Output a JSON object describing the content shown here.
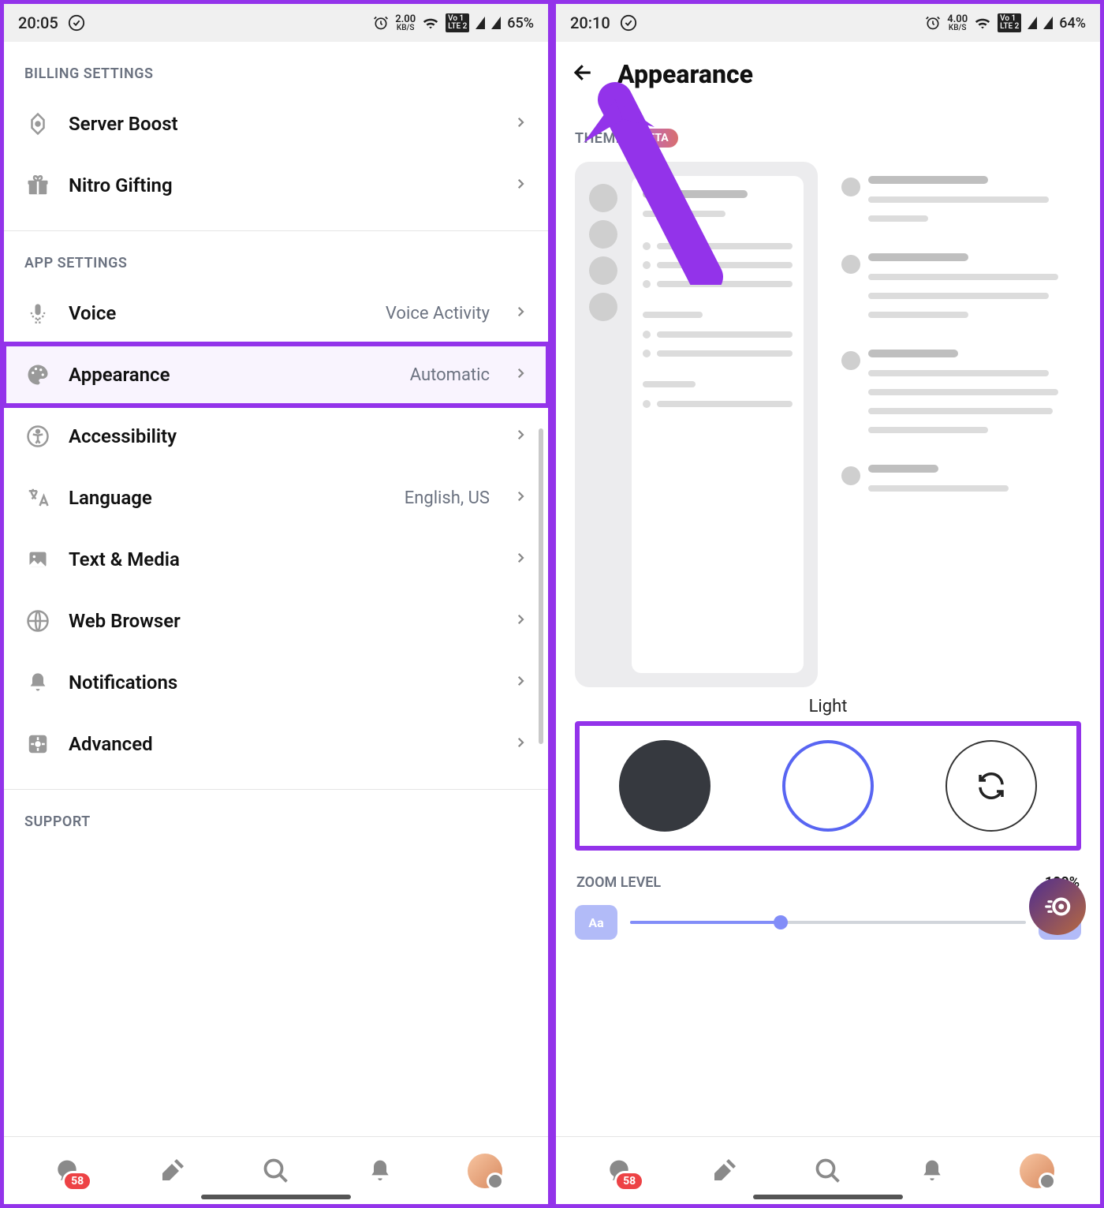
{
  "left": {
    "status": {
      "time": "20:05",
      "kbs_top": "2.00",
      "kbs_bot": "KB/S",
      "lte": "Vo 1\nLTE 2",
      "battery": "65%"
    },
    "sections": {
      "billing_header": "BILLING SETTINGS",
      "billing_items": [
        {
          "label": "Server Boost"
        },
        {
          "label": "Nitro Gifting"
        }
      ],
      "app_header": "APP SETTINGS",
      "app_items": [
        {
          "label": "Voice",
          "value": "Voice Activity"
        },
        {
          "label": "Appearance",
          "value": "Automatic",
          "hl": true
        },
        {
          "label": "Accessibility"
        },
        {
          "label": "Language",
          "value": "English, US"
        },
        {
          "label": "Text & Media"
        },
        {
          "label": "Web Browser"
        },
        {
          "label": "Notifications"
        },
        {
          "label": "Advanced"
        }
      ],
      "support_header": "SUPPORT"
    },
    "nav": {
      "badge": "58"
    }
  },
  "right": {
    "status": {
      "time": "20:10",
      "kbs_top": "4.00",
      "kbs_bot": "KB/S",
      "lte": "Vo 1\nLTE 2",
      "battery": "64%"
    },
    "title": "Appearance",
    "theme_header": "THEME",
    "beta": "BETA",
    "theme_name": "Light",
    "zoom_header": "ZOOM LEVEL",
    "zoom_value": "100%",
    "aa": "Aa",
    "nav": {
      "badge": "58"
    }
  }
}
